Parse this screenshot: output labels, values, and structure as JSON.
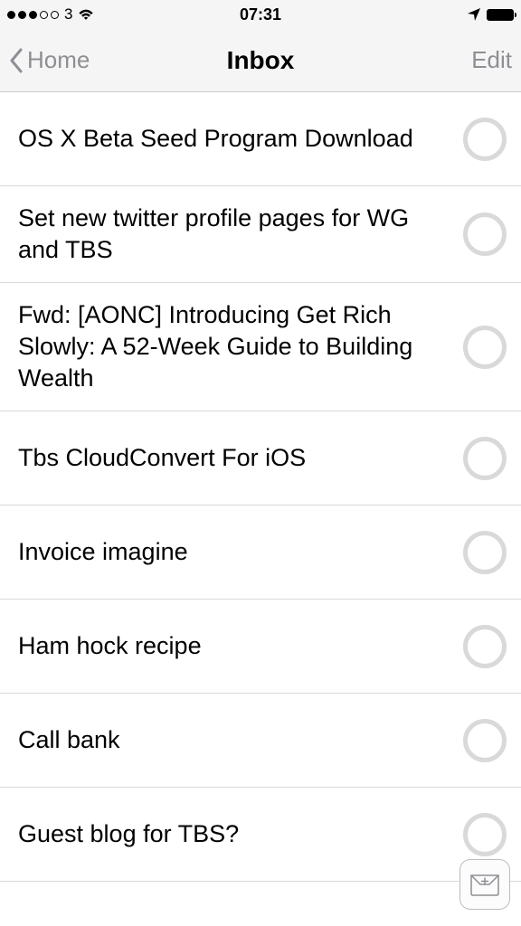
{
  "status": {
    "carrier": "3",
    "time": "07:31"
  },
  "nav": {
    "back_label": "Home",
    "title": "Inbox",
    "edit_label": "Edit"
  },
  "items": [
    {
      "title": "OS X Beta Seed Program Download"
    },
    {
      "title": "Set new twitter profile pages for WG and TBS"
    },
    {
      "title": "Fwd: [AONC] Introducing Get Rich Slowly: A 52-Week Guide to Building Wealth"
    },
    {
      "title": "Tbs CloudConvert For iOS"
    },
    {
      "title": "Invoice imagine"
    },
    {
      "title": "Ham hock recipe"
    },
    {
      "title": "Call bank"
    },
    {
      "title": "Guest blog for TBS?"
    }
  ]
}
